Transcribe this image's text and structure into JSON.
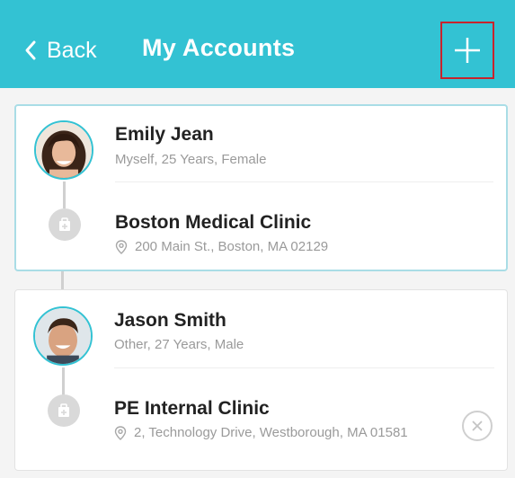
{
  "header": {
    "back_label": "Back",
    "title": "My Accounts",
    "add_icon": "plus-icon",
    "colors": {
      "bar": "#33c2d3",
      "highlight": "#c8232c"
    }
  },
  "accounts": [
    {
      "name": "Emily Jean",
      "details": "Myself, 25 Years, Female",
      "clinic": {
        "name": "Boston Medical Clinic",
        "address": "200 Main St., Boston, MA 02129"
      },
      "selected": true
    },
    {
      "name": "Jason Smith",
      "details": "Other, 27 Years, Male",
      "clinic": {
        "name": "PE Internal Clinic",
        "address": "2, Technology Drive, Westborough, MA 01581"
      },
      "removable": true
    }
  ]
}
